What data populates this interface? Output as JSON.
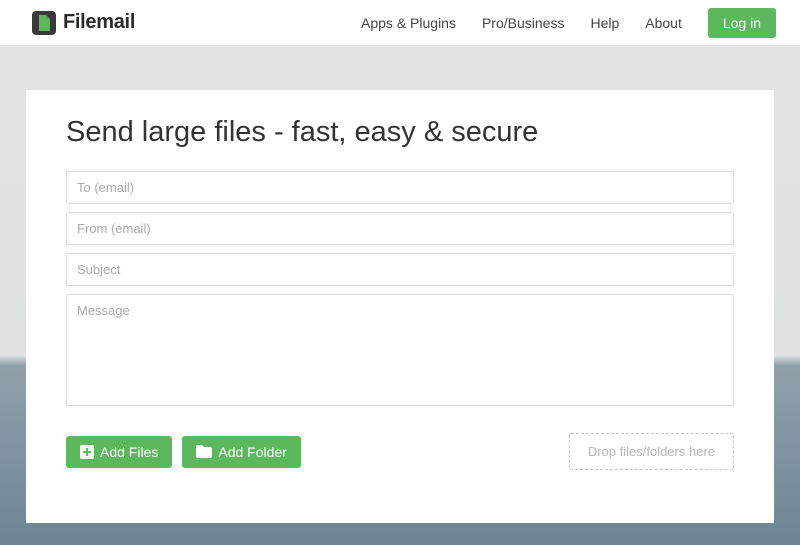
{
  "brand": {
    "name": "Filemail"
  },
  "nav": {
    "items": [
      "Apps & Plugins",
      "Pro/Business",
      "Help",
      "About"
    ],
    "login": "Log in"
  },
  "card": {
    "title": "Send large files - fast, easy & secure",
    "fields": {
      "to_placeholder": "To (email)",
      "from_placeholder": "From (email)",
      "subject_placeholder": "Subject",
      "message_placeholder": "Message"
    },
    "buttons": {
      "add_files": "Add Files",
      "add_folder": "Add Folder"
    },
    "drop_zone": "Drop files/folders here"
  },
  "colors": {
    "accent": "#5cb85c"
  }
}
